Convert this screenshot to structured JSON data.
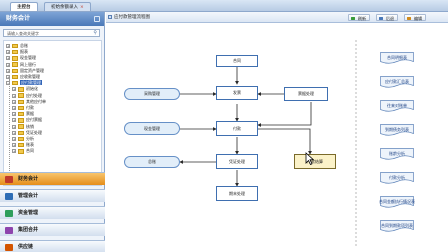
{
  "tabs": [
    {
      "label": "主控台",
      "active": true
    },
    {
      "label": "初始余额录入",
      "close": "×"
    }
  ],
  "sidebar": {
    "title": "财务会计",
    "search_placeholder": "请输入查询关键字",
    "tree": [
      {
        "label": "总账",
        "exp": "+"
      },
      {
        "label": "报表",
        "exp": "+"
      },
      {
        "label": "现金管理",
        "exp": "+"
      },
      {
        "label": "网上银行",
        "exp": "+"
      },
      {
        "label": "固定资产管理",
        "exp": "+"
      },
      {
        "label": "应收款管理",
        "exp": "+"
      },
      {
        "label": "应付款管理",
        "exp": "−",
        "selected": true
      },
      {
        "label": "初始化",
        "exp": "+"
      },
      {
        "label": "应付处理",
        "exp": "+"
      },
      {
        "label": "其他应付单",
        "exp": "+"
      },
      {
        "label": "付款",
        "exp": "+"
      },
      {
        "label": "票据",
        "exp": "+"
      },
      {
        "label": "应付票据",
        "exp": "+"
      },
      {
        "label": "核销",
        "exp": "+"
      },
      {
        "label": "凭证处理",
        "exp": "+"
      },
      {
        "label": "分析",
        "exp": "+"
      },
      {
        "label": "账表",
        "exp": "+"
      },
      {
        "label": "合同",
        "exp": "+"
      }
    ],
    "modules": [
      {
        "label": "财务会计",
        "active": true,
        "color": "#c0392b"
      },
      {
        "label": "管理会计",
        "color": "#2e6db5"
      },
      {
        "label": "资金管理",
        "color": "#2e9e5b"
      },
      {
        "label": "集团合并",
        "color": "#8e44ad"
      },
      {
        "label": "供应链",
        "color": "#d35400"
      }
    ]
  },
  "main": {
    "title": "应付款管理流程图",
    "toolbar": {
      "refresh": "刷新",
      "back": "后退",
      "edit": "编辑"
    },
    "flow": {
      "contract": "合同",
      "purchase": "采购管理",
      "invoice": "发票",
      "bill": "票据处理",
      "cash": "现金管理",
      "payment": "付款",
      "ledger": "总账",
      "voucher": "凭证处理",
      "settle": "付款结算",
      "closing": "期末处理"
    },
    "reports": [
      "合同明细表",
      "应付款汇总表",
      "往来对账单",
      "到期债务列表",
      "账龄分析",
      "付款分析",
      "合同金额执行情况表",
      "合同到期款项列表"
    ]
  },
  "colors": {
    "accent": "#3265b8",
    "module_active": "#e58e1b",
    "flow_line": "#2b2b2b",
    "doc_fill": "#eef4fb"
  }
}
